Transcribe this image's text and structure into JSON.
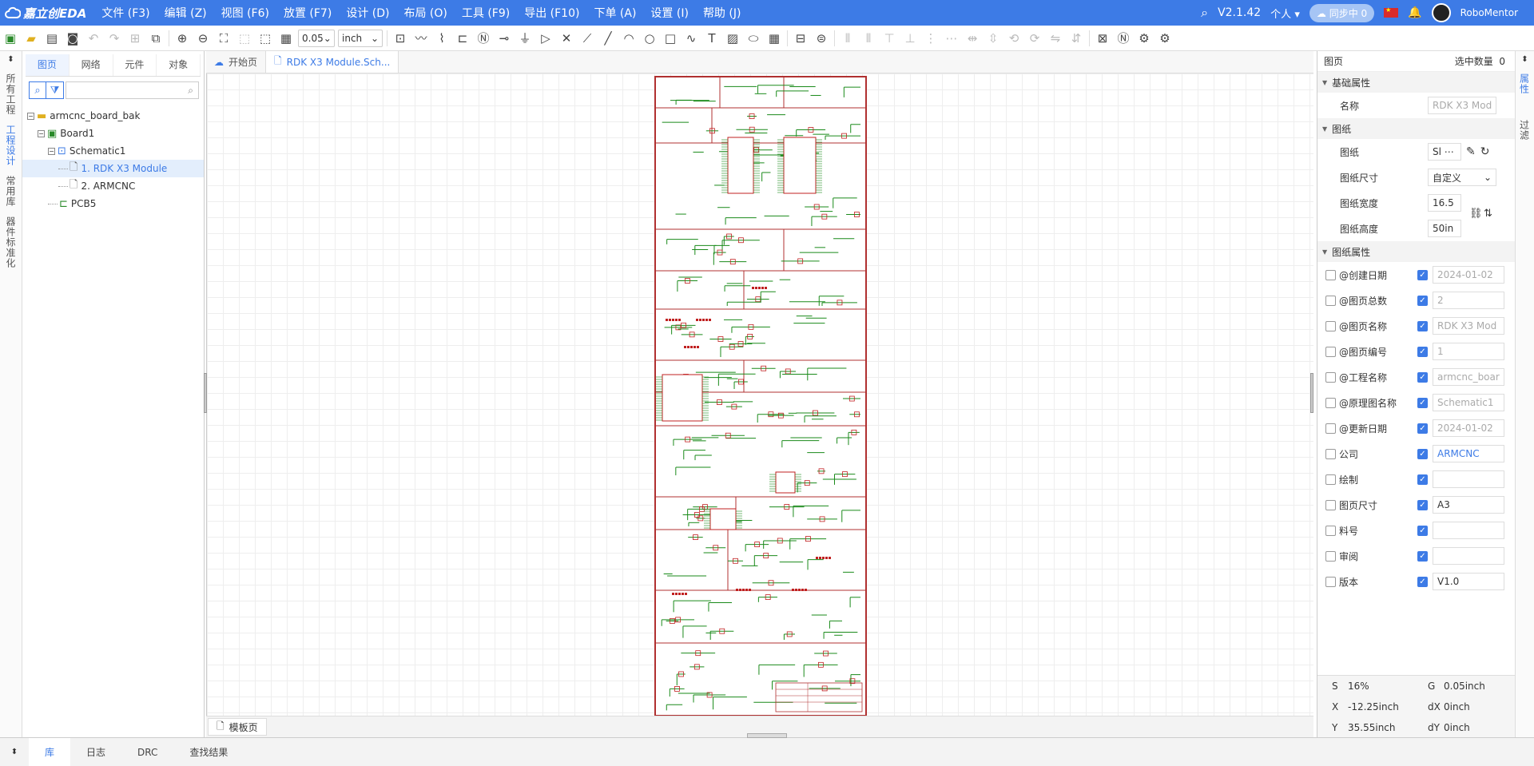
{
  "app": {
    "logo_text": "嘉立创EDA",
    "version": "V2.1.42",
    "personal": "个人",
    "sync": "同步中 0",
    "user": "RoboMentor"
  },
  "menu": [
    "文件 (F3)",
    "编辑 (Z)",
    "视图 (F6)",
    "放置 (F7)",
    "设计 (D)",
    "布局 (O)",
    "工具 (F9)",
    "导出 (F10)",
    "下单 (A)",
    "设置 (I)",
    "帮助 (J)"
  ],
  "toolbar": {
    "grid_value": "0.05",
    "unit_value": "inch"
  },
  "left_rail": [
    "所有工程",
    "工程设计",
    "常用库",
    "器件标准化"
  ],
  "left_panel": {
    "tabs": [
      "图页",
      "网络",
      "元件",
      "对象"
    ],
    "tree": [
      {
        "label": "armcnc_board_bak",
        "level": 0,
        "type": "folder"
      },
      {
        "label": "Board1",
        "level": 1,
        "type": "board"
      },
      {
        "label": "Schematic1",
        "level": 2,
        "type": "schematic"
      },
      {
        "label": "1. RDK X3 Module",
        "level": 3,
        "type": "page",
        "selected": true
      },
      {
        "label": "2. ARMCNC",
        "level": 3,
        "type": "page"
      },
      {
        "label": "PCB5",
        "level": 2,
        "type": "pcb"
      }
    ]
  },
  "editor": {
    "tabs": [
      {
        "label": "开始页"
      },
      {
        "label": "RDK X3 Module.Sch..."
      }
    ],
    "bottom_tab": "模板页"
  },
  "right_panel": {
    "header": "图页",
    "select_count_label": "选中数量",
    "select_count": "0",
    "section_basic": "基础属性",
    "name_label": "名称",
    "name_value": "RDK X3 Mod",
    "section_paper": "图纸",
    "paper_label": "图纸",
    "paper_value": "Sl",
    "paper_size_label": "图纸尺寸",
    "paper_size_value": "自定义",
    "paper_width_label": "图纸宽度",
    "paper_width_value": "16.5",
    "paper_height_label": "图纸高度",
    "paper_height_value": "50in",
    "section_attr": "图纸属性",
    "attrs": [
      {
        "label": "@创建日期",
        "value": "2024-01-02",
        "style": "dis"
      },
      {
        "label": "@图页总数",
        "value": "2",
        "style": "dis"
      },
      {
        "label": "@图页名称",
        "value": "RDK X3 Mod",
        "style": "dis"
      },
      {
        "label": "@图页编号",
        "value": "1",
        "style": "dis"
      },
      {
        "label": "@工程名称",
        "value": "armcnc_boar",
        "style": "dis"
      },
      {
        "label": "@原理图名称",
        "value": "Schematic1",
        "style": "dis"
      },
      {
        "label": "@更新日期",
        "value": "2024-01-02",
        "style": "dis"
      },
      {
        "label": "公司",
        "value": "ARMCNC",
        "style": "blue"
      },
      {
        "label": "绘制",
        "value": "",
        "style": "on"
      },
      {
        "label": "图页尺寸",
        "value": "A3",
        "style": "on"
      },
      {
        "label": "料号",
        "value": "",
        "style": "on"
      },
      {
        "label": "审阅",
        "value": "",
        "style": "on"
      },
      {
        "label": "版本",
        "value": "V1.0",
        "style": "on"
      }
    ],
    "status": {
      "s_label": "S",
      "s_value": "16%",
      "g_label": "G",
      "g_value": "0.05inch",
      "x_label": "X",
      "x_value": "-12.25inch",
      "dx_label": "dX",
      "dx_value": "0inch",
      "y_label": "Y",
      "y_value": "35.55inch",
      "dy_label": "dY",
      "dy_value": "0inch"
    }
  },
  "right_rail": [
    "属性",
    "过滤"
  ],
  "bottom_bar": [
    "库",
    "日志",
    "DRC",
    "查找结果"
  ],
  "colors": {
    "accent": "#3d7be6",
    "sheet_border": "#b03030",
    "wire": "#1a8a1a",
    "component": "#c02020"
  }
}
